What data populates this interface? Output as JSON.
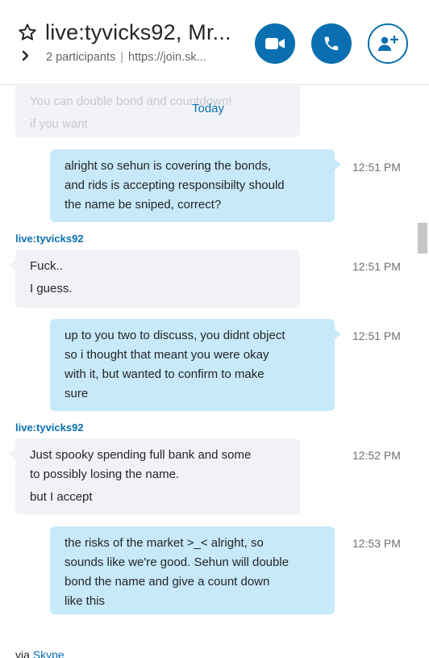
{
  "header": {
    "title": "live:tyvicks92, Mr...",
    "participants": "2 participants",
    "separator": "|",
    "link": "https://join.sk...",
    "icons": {
      "favorite": "star-outline-icon",
      "expand": "chevron-right-icon",
      "video": "video-camera-icon",
      "call": "phone-icon",
      "add": "add-person-icon"
    }
  },
  "conversation": {
    "ghost_lines": [
      "You can double bond and countdown!",
      "if you want"
    ],
    "date_divider": "Today",
    "messages": [
      {
        "direction": "out",
        "lines": [
          "alright so sehun is covering the bonds,",
          "and rids is accepting responsibilty should",
          "the name be sniped, correct?"
        ],
        "time": "12:51 PM"
      },
      {
        "direction": "in",
        "sender": "live:tyvicks92",
        "paragraphs": [
          "Fuck..",
          "I guess."
        ],
        "time": "12:51 PM"
      },
      {
        "direction": "out",
        "lines": [
          "up to you two to discuss, you didnt object",
          "so i thought that meant you were okay",
          "with it, but wanted to confirm to make",
          "sure"
        ],
        "time": "12:51 PM"
      },
      {
        "direction": "in",
        "sender": "live:tyvicks92",
        "paragraphs": [
          "Just spooky spending full bank and some",
          "to possibly losing the name.",
          "but I accept"
        ],
        "time": "12:52 PM"
      },
      {
        "direction": "out",
        "lines": [
          "the risks of the market >_< alright, so",
          "sounds like we're good. Sehun will double",
          "bond the name and give a count down",
          "like this"
        ],
        "time": "12:53 PM"
      }
    ]
  },
  "footer": {
    "prefix": "via",
    "link": "Skype"
  },
  "colors": {
    "accent": "#0a6fb0",
    "outgoing_bubble": "#c7e9fa",
    "incoming_bubble": "#f0f2f6"
  }
}
